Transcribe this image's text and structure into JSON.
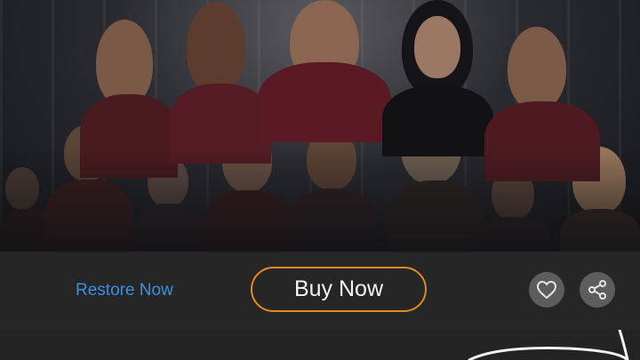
{
  "poster": {
    "icon": "movie-poster-image"
  },
  "actions": {
    "restore_label": "Restore Now",
    "buy_label": "Buy Now",
    "favorite_icon": "heart-icon",
    "share_icon": "share-icon"
  },
  "colors": {
    "accent_orange": "#e08a26",
    "link_blue": "#3d8fe0",
    "background": "#262626",
    "icon_circle": "#5d5d5d"
  }
}
